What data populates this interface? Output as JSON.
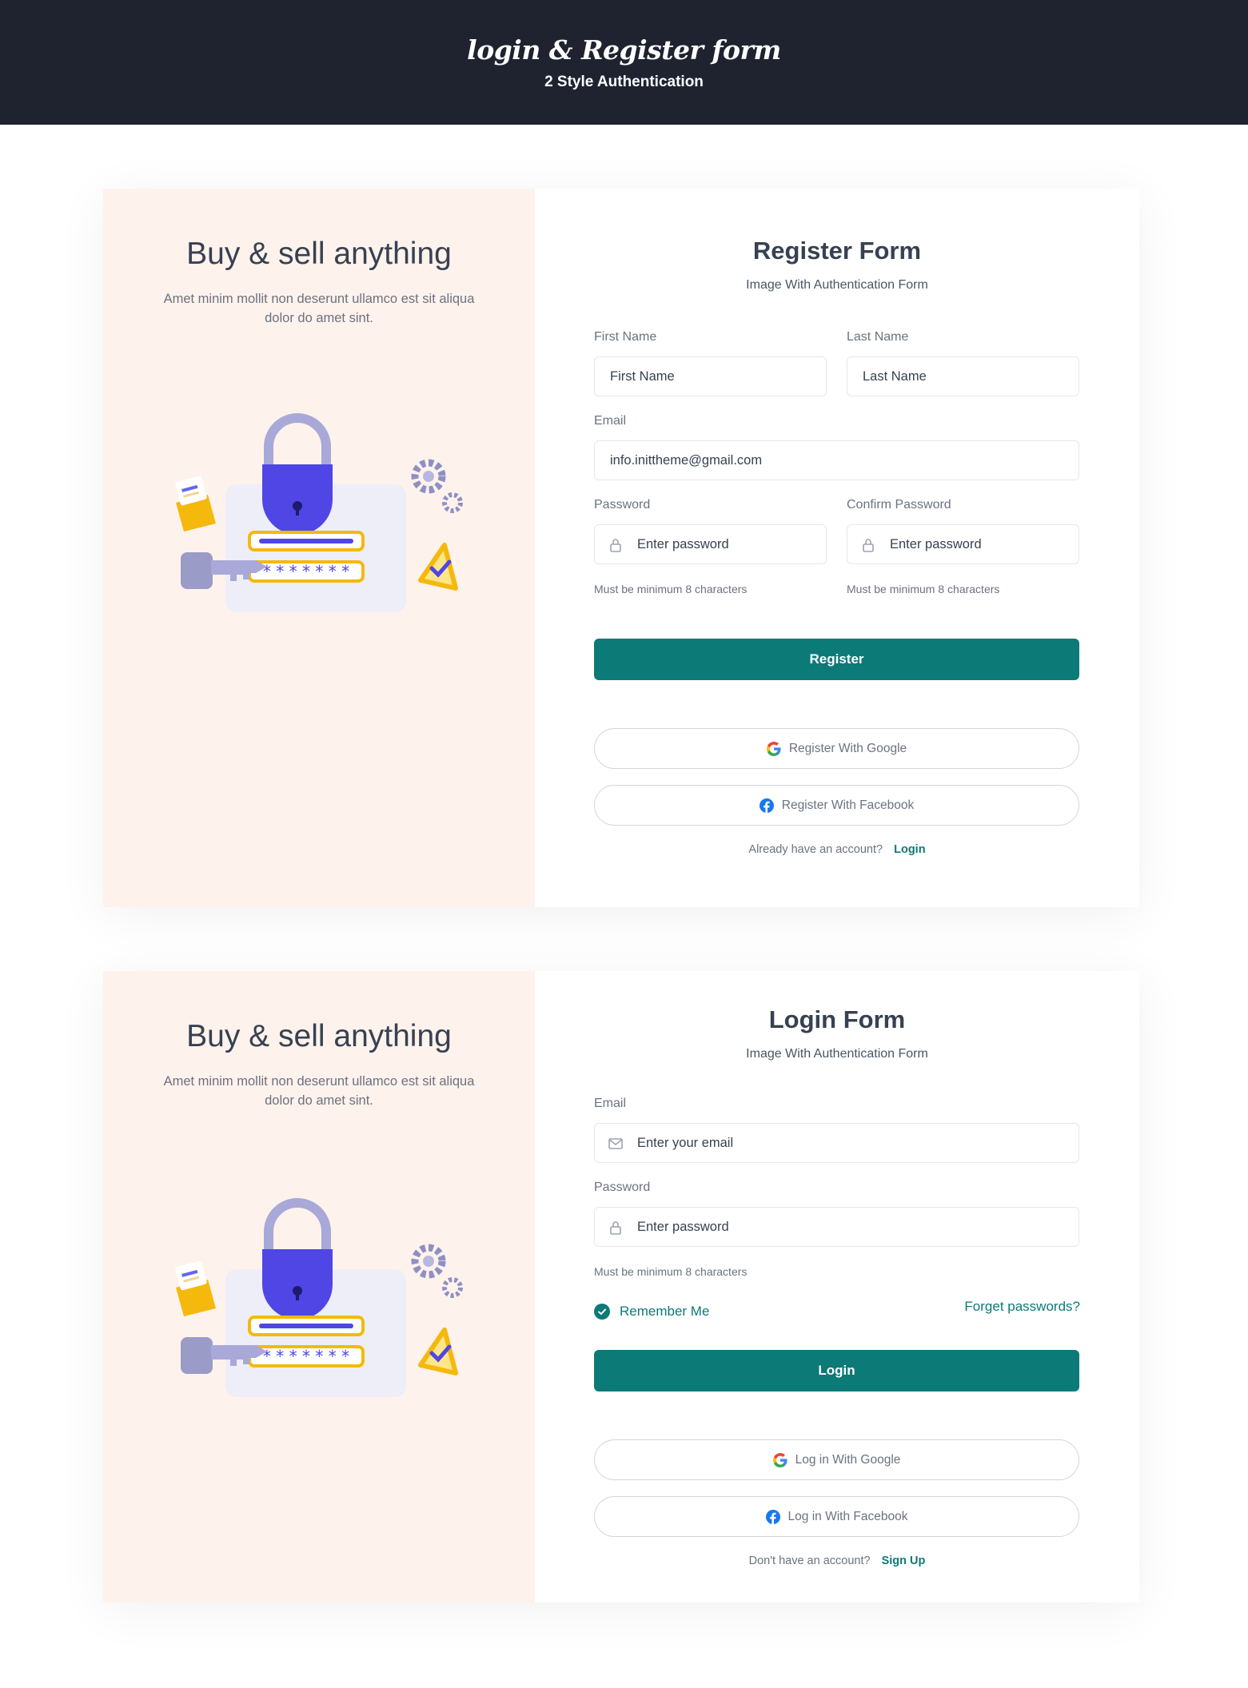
{
  "header": {
    "title": "login & Register form",
    "subtitle": "2 Style Authentication"
  },
  "promo": {
    "title": "Buy & sell anything",
    "text": "Amet minim mollit non deserunt ullamco est sit aliqua dolor do amet sint."
  },
  "register": {
    "title": "Register Form",
    "subtitle": "Image With Authentication Form",
    "first_name_label": "First Name",
    "first_name_placeholder": "First Name",
    "last_name_label": "Last Name",
    "last_name_placeholder": "Last Name",
    "email_label": "Email",
    "email_value": "info.inittheme@gmail.com",
    "password_label": "Password",
    "password_placeholder": "Enter password",
    "confirm_label": "Confirm Password",
    "confirm_placeholder": "Enter password",
    "password_hint": "Must be minimum 8 characters",
    "confirm_hint": "Must be minimum 8 characters",
    "submit": "Register",
    "google": "Register With Google",
    "facebook": "Register With Facebook",
    "switch_text": "Already have an account?",
    "switch_link": "Login"
  },
  "login": {
    "title": "Login Form",
    "subtitle": "Image With Authentication Form",
    "email_label": "Email",
    "email_placeholder": "Enter your email",
    "password_label": "Password",
    "password_placeholder": "Enter password",
    "password_hint": "Must be minimum 8 characters",
    "remember": "Remember Me",
    "forget": "Forget passwords?",
    "submit": "Login",
    "google": "Log in With Google",
    "facebook": "Log in With Facebook",
    "switch_text": "Don't have an account?",
    "switch_link": "Sign Up"
  },
  "colors": {
    "accent": "#0c7a77",
    "header_bg": "#1f2330",
    "promo_bg": "#fef2ec"
  },
  "icons": [
    "lock-icon",
    "mail-icon",
    "google-icon",
    "facebook-icon",
    "check-icon"
  ]
}
